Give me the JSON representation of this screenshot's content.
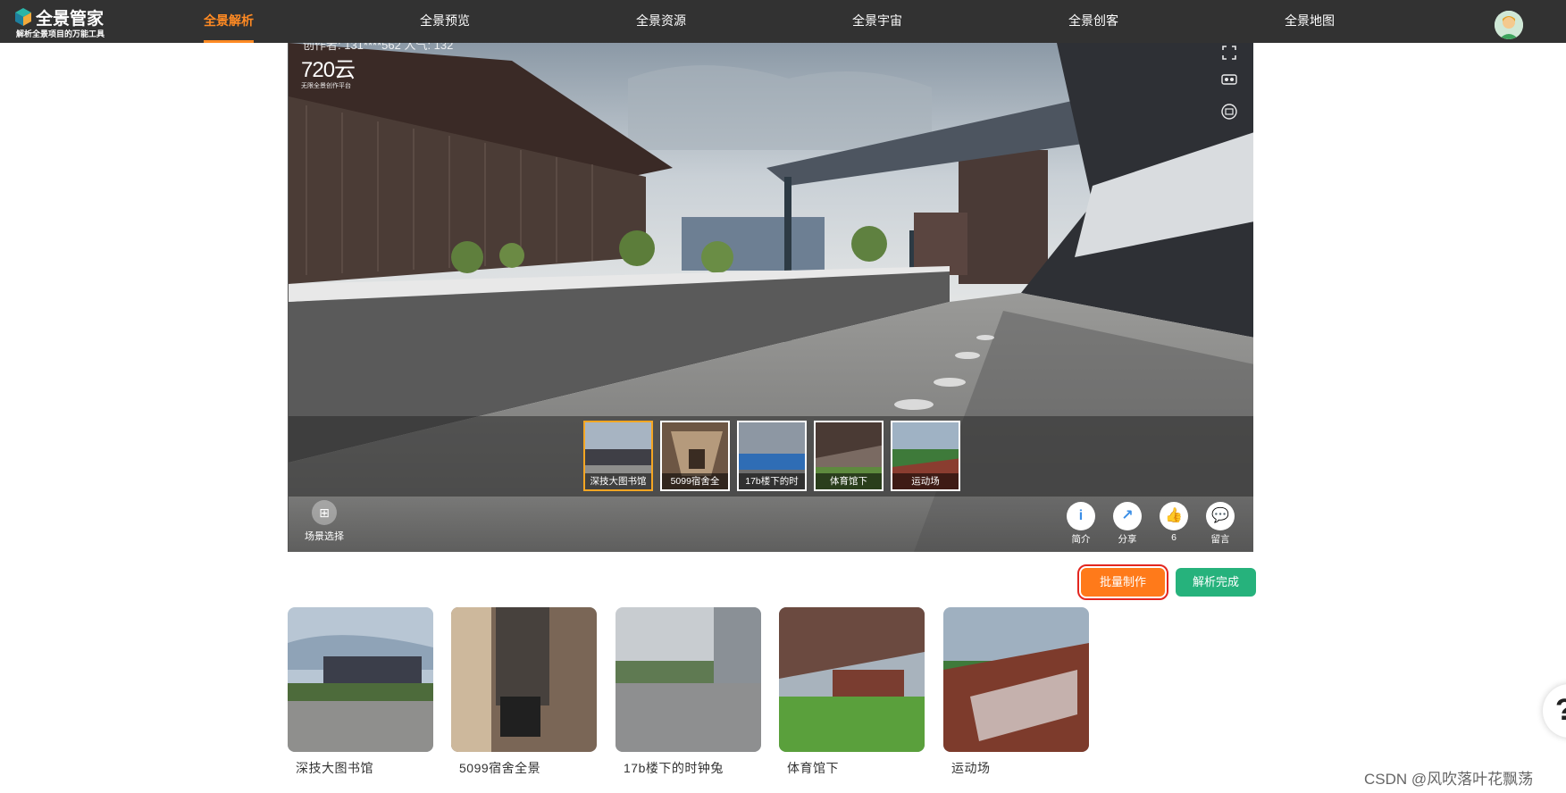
{
  "app": {
    "logo_title": "全景管家",
    "logo_subtitle": "解析全景项目的万能工具"
  },
  "nav": {
    "items": [
      {
        "label": "全景解析",
        "active": true
      },
      {
        "label": "全景预览",
        "active": false
      },
      {
        "label": "全景资源",
        "active": false
      },
      {
        "label": "全景宇宙",
        "active": false
      },
      {
        "label": "全景创客",
        "active": false
      },
      {
        "label": "全景地图",
        "active": false
      }
    ]
  },
  "viewer": {
    "creator_text": "创作者: 131****562  人气: 132",
    "brand_name": "720云",
    "brand_tagline": "无限全景创作平台",
    "scene_select_label": "场景选择",
    "scene_thumbs": [
      {
        "label": "深技大图书馆",
        "selected": true
      },
      {
        "label": "5099宿舍全",
        "selected": false
      },
      {
        "label": "17b楼下的时",
        "selected": false
      },
      {
        "label": "体育馆下",
        "selected": false
      },
      {
        "label": "运动场",
        "selected": false
      }
    ],
    "actions": [
      {
        "icon": "info-icon",
        "glyph": "i",
        "label": "简介"
      },
      {
        "icon": "share-icon",
        "glyph": "↗",
        "label": "分享"
      },
      {
        "icon": "thumbs-up-icon",
        "glyph": "👍",
        "label": "6"
      },
      {
        "icon": "comment-icon",
        "glyph": "💬",
        "label": "留言"
      }
    ]
  },
  "buttons": {
    "batch_label": "批量制作",
    "done_label": "解析完成"
  },
  "gallery": [
    {
      "label": "深技大图书馆"
    },
    {
      "label": "5099宿舍全景"
    },
    {
      "label": "17b楼下的时钟兔"
    },
    {
      "label": "体育馆下"
    },
    {
      "label": "运动场"
    }
  ],
  "help_glyph": "?",
  "watermark": "CSDN @风吹落叶花飘荡",
  "colors": {
    "topbar": "#323232",
    "accent": "#ff8a23",
    "batch_button": "#ff7a1a",
    "done_button": "#26b27c"
  }
}
